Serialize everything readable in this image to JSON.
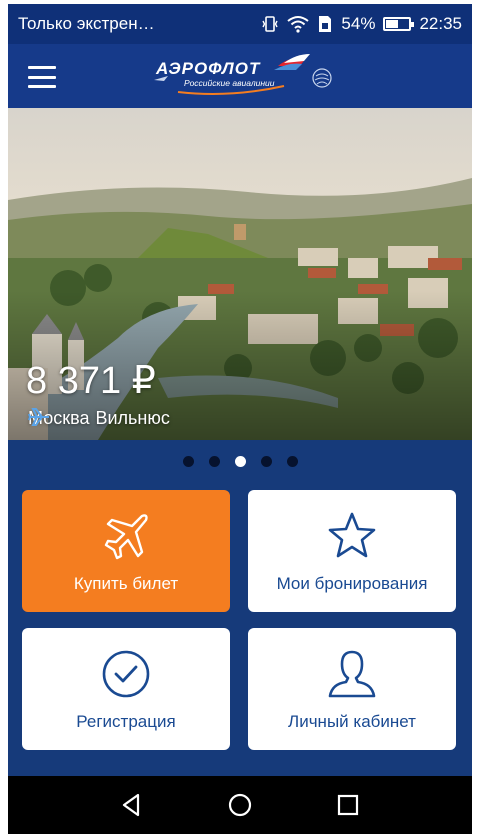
{
  "status_bar": {
    "carrier_text": "Только экстрен…",
    "battery_percent": "54%",
    "battery_level": 0.54,
    "time": "22:35",
    "icons": [
      "vibrate-icon",
      "wifi-icon",
      "sim-icon",
      "battery-icon"
    ]
  },
  "app_bar": {
    "logo_name": "АЭРОФЛОТ",
    "logo_subtitle": "Российские авиалинии"
  },
  "promo": {
    "price": "8 371 ₽",
    "origin": "Москва",
    "destination": "Вильнюс",
    "slides_count": 5,
    "active_slide": 3
  },
  "actions": [
    {
      "label": "Купить билет",
      "icon": "plane-icon"
    },
    {
      "label": "Мои бронирования",
      "icon": "star-icon"
    },
    {
      "label": "Регистрация",
      "icon": "checkmark-icon"
    },
    {
      "label": "Личный кабинет",
      "icon": "person-icon"
    }
  ],
  "colors": {
    "brand_blue": "#163a8a",
    "accent_orange": "#f47d20",
    "label_blue": "#1a4a92"
  }
}
